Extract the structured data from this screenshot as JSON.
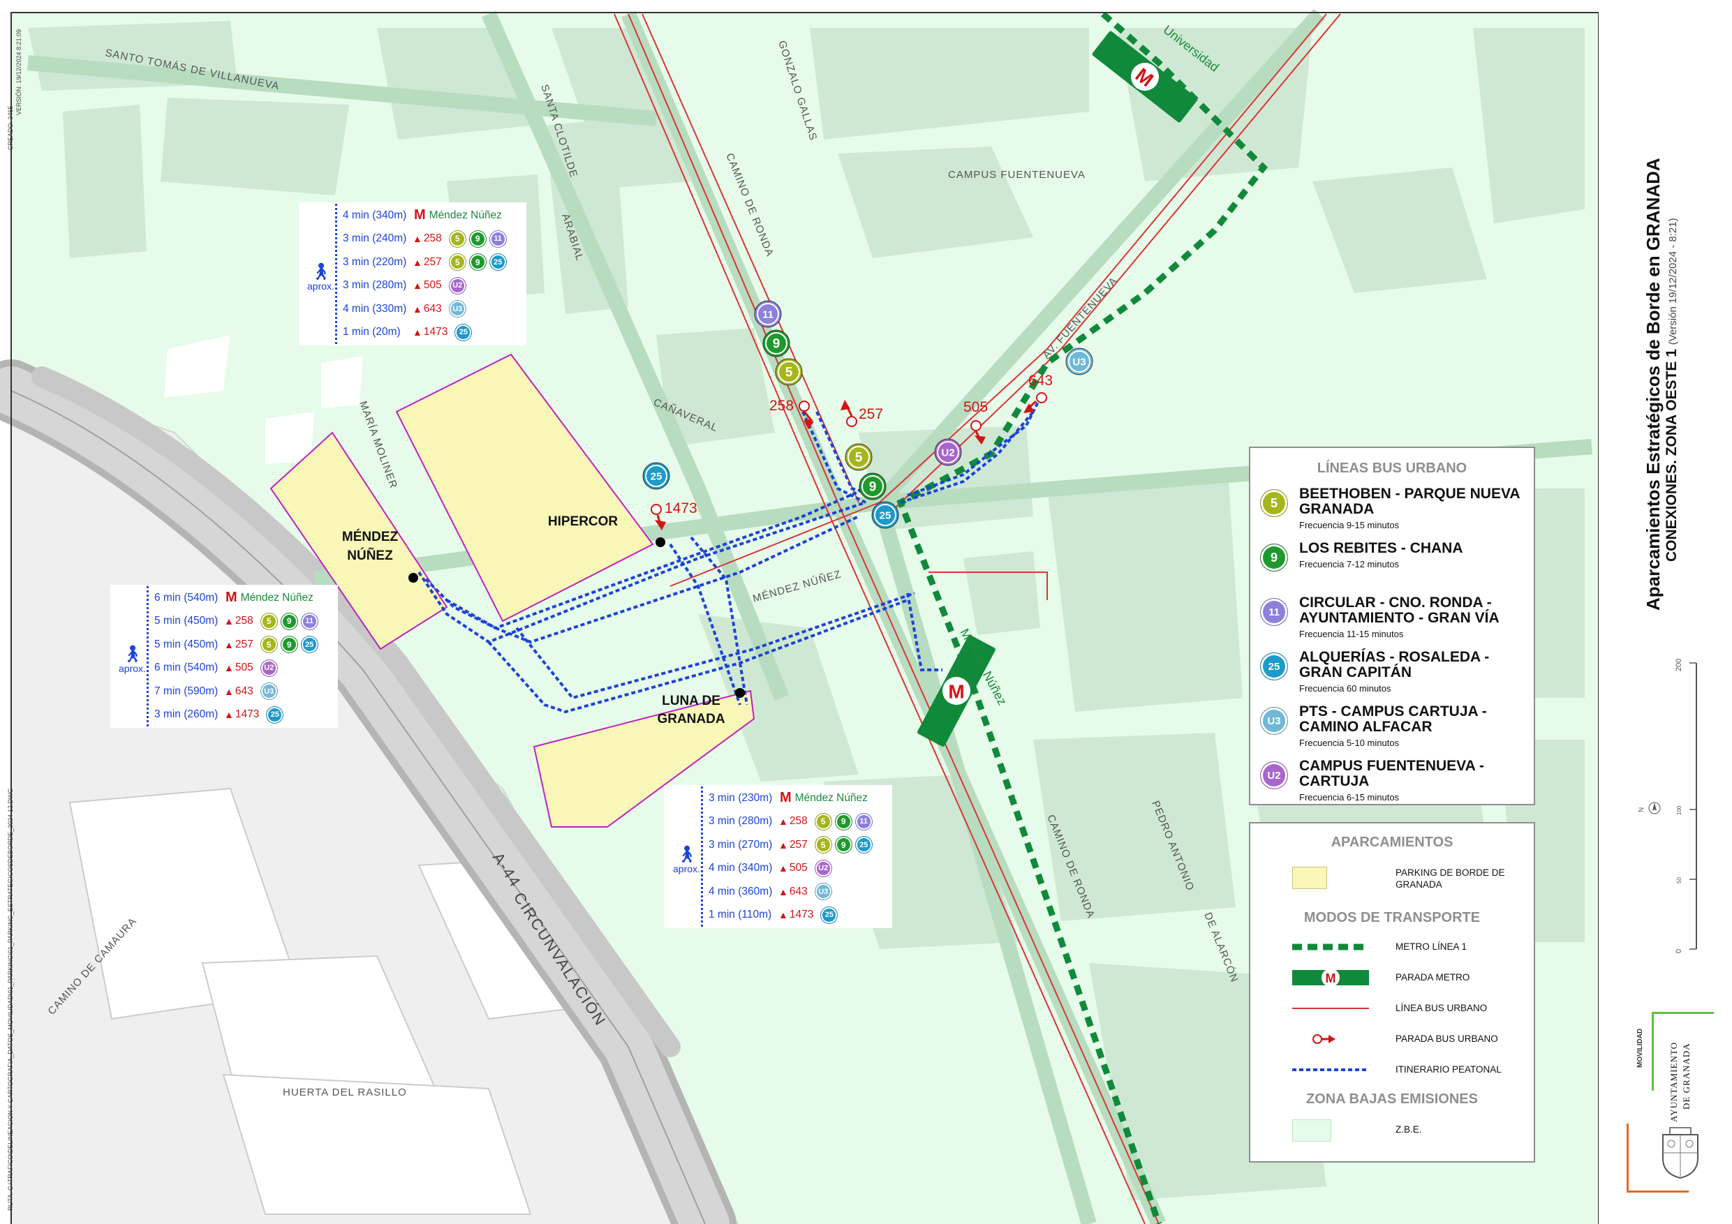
{
  "title": {
    "main": "Aparcamientos Estratégicos de Borde en GRANADA",
    "sub": "CONEXIONES. ZONA OESTE 1",
    "version": "(Versión 19/12/2024 - 8:21)"
  },
  "side_meta": {
    "created": "CREADO: 3465",
    "version": "VERSIÓN: 19/12/2024 8:21:09",
    "path": "RUTA: G:\\TRAFICO\\DELINEACION Y CARTOGRAFIA_DATOS_MOVILIDAD\\01_PARKING\\01_PARKING_ESTRATEGICOSDEBORDE_2024-12.DWG"
  },
  "streets": {
    "santo_tomas": "SANTO TOMÁS DE VILLANUEVA",
    "santa_clotilde": "SANTA CLOTILDE",
    "gonzalo_gallas": "GONZALO GALLAS",
    "camino_de_ronda_n": "CAMINO DE RONDA",
    "arabial": "ARABIAL",
    "campus_fuentenueva": "CAMPUS FUENTENUEVA",
    "av_fuentenueva": "AV. FUENTENUEVA",
    "maria_moliner": "MARÍA MOLINER",
    "canaveral": "CAÑAVERAL",
    "mendez_nunez_street": "MÉNDEZ NÚÑEZ",
    "camino_de_ronda_s": "CAMINO DE RONDA",
    "pedro_antonio": "PEDRO ANTONIO",
    "de_alarcon": "DE ALARCÓN",
    "a44": "A-44",
    "circunvalacion": "CIRCUNVALACIÓN",
    "camino_de_camaura": "CAMINO DE CAMAURA",
    "huerta_del_rasillo": "HUERTA DEL RASILLO"
  },
  "parkings": {
    "mendez_1": "MÉNDEZ",
    "mendez_2": "NÚÑEZ",
    "hipercor": "HIPERCOR",
    "luna_1": "LUNA DE",
    "luna_2": "GRANADA"
  },
  "metro_stops": {
    "universidad": "Universidad",
    "mendez_nunez": "Méndez Núñez",
    "symbol": "M"
  },
  "stops": {
    "s258": "258",
    "s257": "257",
    "s505": "505",
    "s643": "643",
    "s1473": "1473"
  },
  "colors": {
    "zbe": "#e6fbe9",
    "zbe_border": "#bfe2c5",
    "block": "#cfe8d3",
    "parking": "#f8f7b7",
    "parking_border": "#c020c0",
    "metro": "#10893b",
    "bus_line": "#d93535",
    "walk": "#1b43d6",
    "l5": "#a6b51c",
    "l9": "#1e9a2d",
    "l11": "#8b80dc",
    "l25": "#1c9acb",
    "lU3": "#6fb8d8",
    "lU2": "#a866cc"
  },
  "boxes": {
    "hipercor": {
      "walk_label": "aprox.",
      "metro_label": "Méndez Núñez",
      "rows": [
        {
          "time": "4 min (340m)",
          "type": "metro",
          "lines": []
        },
        {
          "time": "3 min (240m)",
          "type": "bus",
          "stop": "258",
          "lines": [
            "5",
            "9",
            "11"
          ]
        },
        {
          "time": "3 min (220m)",
          "type": "bus",
          "stop": "257",
          "lines": [
            "5",
            "9",
            "25"
          ]
        },
        {
          "time": "3 min (280m)",
          "type": "bus",
          "stop": "505",
          "lines": [
            "U2"
          ]
        },
        {
          "time": "4 min (330m)",
          "type": "bus",
          "stop": "643",
          "lines": [
            "U3"
          ]
        },
        {
          "time": "1 min (20m)",
          "type": "bus",
          "stop": "1473",
          "lines": [
            "25"
          ]
        }
      ]
    },
    "mendez": {
      "walk_label": "aprox.",
      "metro_label": "Méndez Núñez",
      "rows": [
        {
          "time": "6 min (540m)",
          "type": "metro",
          "lines": []
        },
        {
          "time": "5 min (450m)",
          "type": "bus",
          "stop": "258",
          "lines": [
            "5",
            "9",
            "11"
          ]
        },
        {
          "time": "5 min (450m)",
          "type": "bus",
          "stop": "257",
          "lines": [
            "5",
            "9",
            "25"
          ]
        },
        {
          "time": "6 min (540m)",
          "type": "bus",
          "stop": "505",
          "lines": [
            "U2"
          ]
        },
        {
          "time": "7 min (590m)",
          "type": "bus",
          "stop": "643",
          "lines": [
            "U3"
          ]
        },
        {
          "time": "3 min (260m)",
          "type": "bus",
          "stop": "1473",
          "lines": [
            "25"
          ]
        }
      ]
    },
    "luna": {
      "walk_label": "aprox.",
      "metro_label": "Méndez Núñez",
      "rows": [
        {
          "time": "3 min (230m)",
          "type": "metro",
          "lines": []
        },
        {
          "time": "3 min (280m)",
          "type": "bus",
          "stop": "258",
          "lines": [
            "5",
            "9",
            "11"
          ]
        },
        {
          "time": "3 min (270m)",
          "type": "bus",
          "stop": "257",
          "lines": [
            "5",
            "9",
            "25"
          ]
        },
        {
          "time": "4 min (340m)",
          "type": "bus",
          "stop": "505",
          "lines": [
            "U2"
          ]
        },
        {
          "time": "4 min (360m)",
          "type": "bus",
          "stop": "643",
          "lines": [
            "U3"
          ]
        },
        {
          "time": "1 min (110m)",
          "type": "bus",
          "stop": "1473",
          "lines": [
            "25"
          ]
        }
      ]
    }
  },
  "bus_legend": {
    "header": "LÍNEAS BUS URBANO",
    "items": [
      {
        "code": "5",
        "name": "BEETHOBEN - PARQUE NUEVA GRANADA",
        "freq": "Frecuencia 9-15 minutos"
      },
      {
        "code": "9",
        "name": "LOS REBITES - CHANA",
        "freq": "Frecuencia 7-12 minutos"
      },
      {
        "code": "11",
        "name": "CIRCULAR - CNO. RONDA - AYUNTAMIENTO - GRAN VÍA",
        "freq": "Frecuencia 11-15 minutos"
      },
      {
        "code": "25",
        "name": "ALQUERÍAS - ROSALEDA - GRAN CAPITÁN",
        "freq": "Frecuencia 60 minutos"
      },
      {
        "code": "U3",
        "name": "PTS - CAMPUS CARTUJA - CAMINO ALFACAR",
        "freq": "Frecuencia 5-10 minutos"
      },
      {
        "code": "U2",
        "name": "CAMPUS FUENTENUEVA - CARTUJA",
        "freq": "Frecuencia 6-15 minutos"
      }
    ]
  },
  "map_legend": {
    "h_parking": "APARCAMIENTOS",
    "parking": "PARKING DE BORDE DE GRANADA",
    "h_modes": "MODOS DE TRANSPORTE",
    "metro_line": "METRO LÍNEA 1",
    "metro_stop": "PARADA METRO",
    "bus_line": "LÍNEA BUS URBANO",
    "bus_stop": "PARADA BUS URBANO",
    "walk": "ITINERARIO PEATONAL",
    "h_zbe": "ZONA BAJAS EMISIONES",
    "zbe": "Z.B.E."
  },
  "scale": {
    "ticks": [
      "200",
      "100",
      "50",
      "0"
    ],
    "north": "N"
  },
  "logo": {
    "dept": "MOVILIDAD",
    "line1": "AYUNTAMIENTO",
    "line2": "DE GRANADA"
  }
}
